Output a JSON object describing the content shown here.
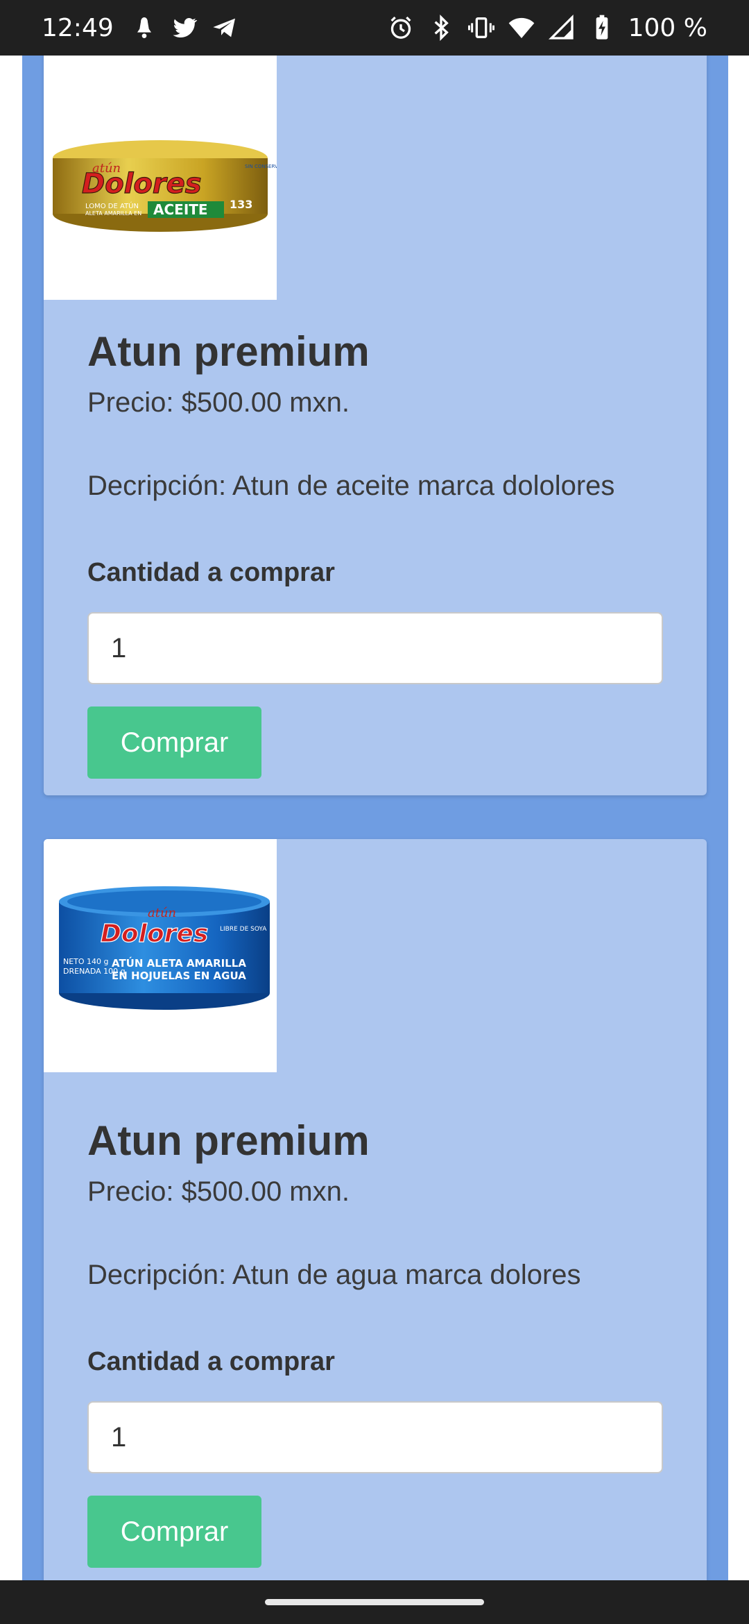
{
  "status_bar": {
    "time": "12:49",
    "battery": "100 %",
    "left_icons": [
      "notification-icon",
      "twitter-icon",
      "telegram-icon"
    ],
    "right_icons": [
      "alarm-icon",
      "bluetooth-icon",
      "vibrate-icon",
      "wifi-icon",
      "signal-icon",
      "battery-charging-icon"
    ]
  },
  "products": [
    {
      "image": "tuna-can-oil-icon",
      "title": "Atun premium",
      "price": "Precio: $500.00 mxn.",
      "description": "Decripción: Atun de aceite marca dololores",
      "quantity_label": "Cantidad a comprar",
      "quantity_value": "1",
      "buy_label": "Comprar",
      "image_text": {
        "brand": "Dolores",
        "sub": "atún",
        "line1": "LOMO DE ATÚN",
        "line2": "ALETA AMARILLA EN",
        "kind": "ACEITE",
        "weight": "133",
        "corner": "SIN CONSERVADORES"
      }
    },
    {
      "image": "tuna-can-water-icon",
      "title": "Atun premium",
      "price": "Precio: $500.00 mxn.",
      "description": "Decripción: Atun de agua marca dolores",
      "quantity_label": "Cantidad a comprar",
      "quantity_value": "1",
      "buy_label": "Comprar",
      "image_text": {
        "brand": "Dolores",
        "sub": "atún",
        "line1": "ATÚN ALETA AMARILLA",
        "line2": "EN HOJUELAS EN AGUA",
        "net1": "NETO 140 g",
        "net2": "DRENADA 100 g",
        "badge": "LIBRE DE SOYA"
      }
    }
  ],
  "colors": {
    "status_bar": "#202020",
    "page_background": "#6f9de2",
    "card_background": "#adc6ef",
    "button": "#48c78e"
  }
}
